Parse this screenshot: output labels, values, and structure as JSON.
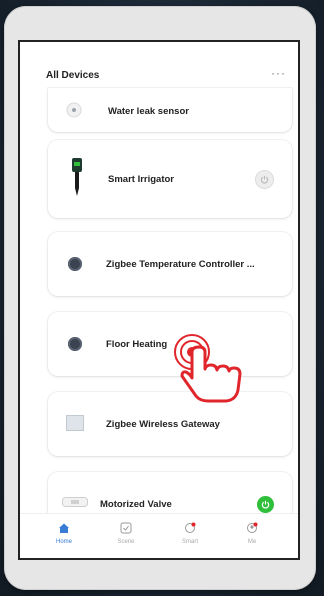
{
  "header": {
    "title": "All Devices",
    "more_label": "···"
  },
  "devices": [
    {
      "name": "Water leak sensor",
      "icon": "water-leak-sensor-icon",
      "power": null
    },
    {
      "name": "Smart Irrigator",
      "icon": "smart-irrigator-icon",
      "power": "off"
    },
    {
      "name": "Zigbee Temperature Controller ...",
      "icon": "thermostat-icon",
      "power": null
    },
    {
      "name": "Floor Heating",
      "icon": "thermostat-icon",
      "power": null
    },
    {
      "name": "Zigbee Wireless Gateway",
      "icon": "gateway-icon",
      "power": null
    },
    {
      "name": "Motorized Valve",
      "icon": "valve-icon",
      "power": "on"
    }
  ],
  "tabs": [
    {
      "label": "Home",
      "icon": "home-icon",
      "active": true
    },
    {
      "label": "Scene",
      "icon": "scene-icon",
      "active": false
    },
    {
      "label": "Smart",
      "icon": "smart-icon",
      "active": false
    },
    {
      "label": "Me",
      "icon": "me-icon",
      "active": false
    }
  ],
  "colors": {
    "accent": "#3a7bd5",
    "power_on": "#2fbf3a",
    "tap_hand": "#e0262b"
  }
}
